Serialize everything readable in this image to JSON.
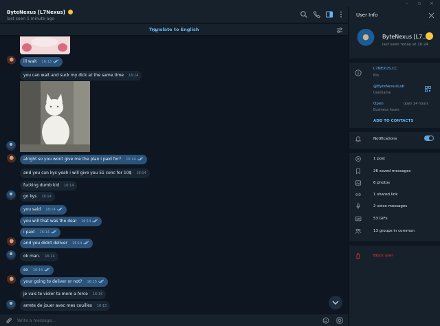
{
  "chat": {
    "name": "ByteNexus [L7Nexus]",
    "status": "last seen 1 minute ago",
    "translate_label": "Translate to English",
    "composer_placeholder": "Write a message..."
  },
  "messages": [
    {
      "side": "out",
      "text": "ill wait",
      "time": "16:13",
      "ticks": true
    },
    {
      "side": "in",
      "text": "you can wait and suck my dick at the same time",
      "time": "16:14"
    },
    {
      "side": "out",
      "text": "alright so you wont give me the plan i paid for?",
      "time": "16:14",
      "ticks": true
    },
    {
      "side": "in",
      "text": "and you can kys yeah i will give you 51 conc for 10$",
      "time": "16:14"
    },
    {
      "side": "in",
      "text": "fucking dumb kid",
      "time": "16:14"
    },
    {
      "side": "in",
      "text": "go kys",
      "time": "16:14"
    },
    {
      "side": "out",
      "text": "you said",
      "time": "16:14",
      "ticks": true
    },
    {
      "side": "out",
      "text": "you will that was the deal",
      "time": "16:14",
      "ticks": true
    },
    {
      "side": "out",
      "text": "i paid",
      "time": "16:14",
      "ticks": true
    },
    {
      "side": "out",
      "text": "and you didnt deliver",
      "time": "16:14",
      "ticks": true
    },
    {
      "side": "in",
      "text": "ok man.",
      "time": "16:14"
    },
    {
      "side": "out",
      "text": "so",
      "time": "16:14",
      "ticks": true
    },
    {
      "side": "out",
      "text": "your going to deliver or not?",
      "time": "16:15",
      "ticks": true
    },
    {
      "side": "in",
      "text": "je vais te violer ta mere a force",
      "time": "16:15"
    },
    {
      "side": "in",
      "text": "arrete de jouer avec mes couilles",
      "time": "16:15"
    }
  ],
  "panel": {
    "title": "User Info",
    "name": "ByteNexus [L7...",
    "status": "last seen today at 16:24",
    "bio_value": "L7NEXUS.CC",
    "bio_label": "Bio",
    "username_value": "@ByteNexusLab",
    "username_label": "Username",
    "hours_value": "Open",
    "hours_right": "open 24 hours",
    "hours_label": "Business hours",
    "add_contact": "ADD TO CONTACTS",
    "notifications": "Notifications",
    "notifications_on": true,
    "stats": [
      "1 post",
      "26 saved messages",
      "6 photos",
      "1 shared link",
      "2 voice messages",
      "53 GIFs",
      "13 groups in common"
    ],
    "block": "Block user"
  },
  "colors": {
    "accent": "#6ab3f3",
    "out_bubble": "#2b5278",
    "in_bubble": "#182533",
    "danger": "#ec3942"
  }
}
